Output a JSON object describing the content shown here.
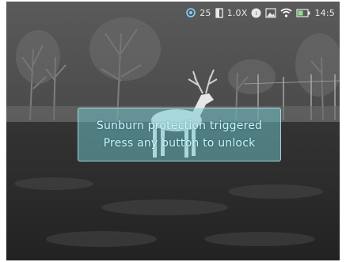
{
  "status_bar": {
    "battery_temp_icon": "shield-icon",
    "level_value": "25",
    "zoom_icon": "zoom-level-icon",
    "zoom_value": "1.0X",
    "recording_icon": "record-badge-icon",
    "image_mode_icon": "image-mode-icon",
    "wifi_icon": "wifi-icon",
    "battery_icon": "battery-icon",
    "time": "14:5"
  },
  "toast": {
    "line1": "Sunburn protection triggered",
    "line2": "Press any button to unlock"
  },
  "colors": {
    "toast_bg": "#6ec8cd",
    "toast_text": "#c8f6ff",
    "status_text": "#e8e8e8"
  }
}
